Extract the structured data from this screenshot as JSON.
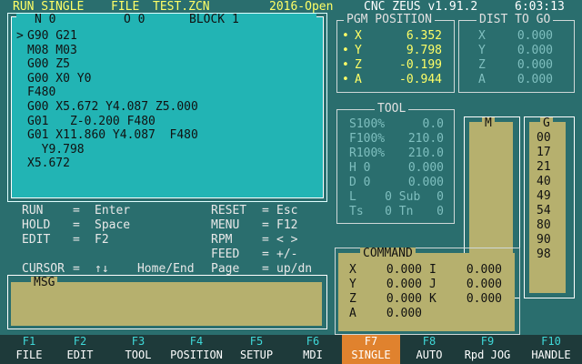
{
  "header": {
    "mode": "RUN SINGLE",
    "file_label": "FILE",
    "file_name": "TEST.ZCN",
    "edition": "2016-Open",
    "app": "CNC ZEUS v1.91.2",
    "clock": "6:03:13"
  },
  "program": {
    "n_label": "N 0",
    "o_label": "O 0",
    "block_label": "BLOCK 1",
    "cursor": ">",
    "lines": [
      "G90 G21",
      "M08 M03",
      "G00 Z5",
      "G00 X0 Y0",
      "F480",
      "G00 X5.672 Y4.087 Z5.000",
      "G01   Z-0.200 F480",
      "G01 X11.860 Y4.087  F480",
      "  Y9.798",
      "X5.672"
    ]
  },
  "pgm_position": {
    "title": "PGM POSITION",
    "axes": [
      {
        "dot": "•",
        "axis": "X",
        "value": "6.352"
      },
      {
        "dot": "•",
        "axis": "Y",
        "value": "9.798"
      },
      {
        "dot": "•",
        "axis": "Z",
        "value": "-0.199"
      },
      {
        "dot": "•",
        "axis": "A",
        "value": "-0.944"
      }
    ]
  },
  "dist_to_go": {
    "title": "DIST TO GO",
    "axes": [
      {
        "axis": "X",
        "value": "0.000"
      },
      {
        "axis": "Y",
        "value": "0.000"
      },
      {
        "axis": "Z",
        "value": "0.000"
      },
      {
        "axis": "A",
        "value": "0.000"
      }
    ]
  },
  "tool": {
    "title": "TOOL",
    "rows": [
      {
        "left": "S100%",
        "right": "0.0"
      },
      {
        "left": "F100%",
        "right": "210.0"
      },
      {
        "left": "R100%",
        "right": "210.0"
      },
      {
        "left": "H 0",
        "right": "0.000"
      },
      {
        "left": "D 0",
        "right": "0.000"
      },
      {
        "left": "L    0 Sub",
        "right": "0"
      },
      {
        "left": "Ts   0 Tn",
        "right": "0"
      }
    ]
  },
  "help": {
    "left": [
      {
        "key": "RUN",
        "eq": "=",
        "val": "Enter"
      },
      {
        "key": "HOLD",
        "eq": "=",
        "val": "Space"
      },
      {
        "key": "EDIT",
        "eq": "=",
        "val": "F2"
      },
      {
        "key": "CURSOR",
        "eq": "=",
        "val": "↑↓    Home/End"
      }
    ],
    "right": [
      {
        "key": "RESET",
        "eq": "=",
        "val": "Esc"
      },
      {
        "key": "MENU",
        "eq": "=",
        "val": "F12"
      },
      {
        "key": "RPM",
        "eq": "=",
        "val": "< >"
      },
      {
        "key": "FEED",
        "eq": "=",
        "val": "+/-"
      },
      {
        "key": "Page",
        "eq": "=",
        "val": "up/dn"
      }
    ]
  },
  "msg": {
    "label": "MSG"
  },
  "m_panel": {
    "label": "M"
  },
  "g_panel": {
    "label": "G",
    "codes": [
      "00",
      "17",
      "21",
      "40",
      "49",
      "54",
      "80",
      "90",
      "98"
    ]
  },
  "command": {
    "title": "COMMAND",
    "rows": [
      {
        "a": "X",
        "av": "0.000",
        "b": "I",
        "bv": "0.000"
      },
      {
        "a": "Y",
        "av": "0.000",
        "b": "J",
        "bv": "0.000"
      },
      {
        "a": "Z",
        "av": "0.000",
        "b": "K",
        "bv": "0.000"
      },
      {
        "a": "A",
        "av": "0.000",
        "b": "",
        "bv": ""
      }
    ]
  },
  "fkeys": [
    {
      "num": "F1",
      "label": "FILE"
    },
    {
      "num": "F2",
      "label": "EDIT"
    },
    {
      "num": "F3",
      "label": "TOOL"
    },
    {
      "num": "F4",
      "label": "POSITION"
    },
    {
      "num": "F5",
      "label": "SETUP"
    },
    {
      "num": "F6",
      "label": "MDI"
    },
    {
      "num": "F7",
      "label": "SINGLE"
    },
    {
      "num": "F8",
      "label": "AUTO"
    },
    {
      "num": "F9",
      "label": "Rpd JOG"
    },
    {
      "num": "F10",
      "label": "HANDLE"
    }
  ],
  "colors": {
    "background": "#2a6e6e",
    "program_bg": "#22b4b4",
    "panel_olive": "#b6b06e",
    "highlight_yellow": "#ffff66",
    "active_key": "#e0822e"
  }
}
